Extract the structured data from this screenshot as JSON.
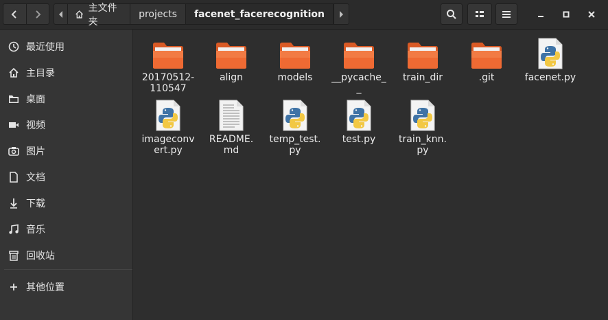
{
  "header": {
    "back_icon": "chevron-left-icon",
    "forward_icon": "chevron-right-icon",
    "breadcrumb": [
      {
        "label": "主文件夹",
        "icon": "home-icon"
      },
      {
        "label": "projects"
      },
      {
        "label": "facenet_facerecognition",
        "current": true
      }
    ],
    "buttons": [
      "search-icon",
      "view-options-icon",
      "menu-icon"
    ],
    "window_controls": [
      "minimize-icon",
      "maximize-icon",
      "close-icon"
    ]
  },
  "sidebar": {
    "items": [
      {
        "label": "最近使用",
        "icon": "clock-icon"
      },
      {
        "label": "主目录",
        "icon": "home-icon"
      },
      {
        "label": "桌面",
        "icon": "folder-icon"
      },
      {
        "label": "视频",
        "icon": "video-icon"
      },
      {
        "label": "图片",
        "icon": "camera-icon"
      },
      {
        "label": "文档",
        "icon": "document-icon"
      },
      {
        "label": "下载",
        "icon": "download-icon"
      },
      {
        "label": "音乐",
        "icon": "music-icon"
      },
      {
        "label": "回收站",
        "icon": "trash-icon"
      },
      {
        "label": "其他位置",
        "icon": "plus-icon"
      }
    ]
  },
  "files": [
    {
      "name_lines": [
        "20170512-",
        "110547"
      ],
      "type": "folder"
    },
    {
      "name_lines": [
        "align"
      ],
      "type": "folder"
    },
    {
      "name_lines": [
        "models"
      ],
      "type": "folder"
    },
    {
      "name_lines": [
        "__pycache_",
        "_"
      ],
      "type": "folder"
    },
    {
      "name_lines": [
        "train_dir"
      ],
      "type": "folder"
    },
    {
      "name_lines": [
        ".git"
      ],
      "type": "folder"
    },
    {
      "name_lines": [
        "facenet.py"
      ],
      "type": "python"
    },
    {
      "name_lines": [
        "imageconv",
        "ert.py"
      ],
      "type": "python"
    },
    {
      "name_lines": [
        "README.",
        "md"
      ],
      "type": "text"
    },
    {
      "name_lines": [
        "temp_test.",
        "py"
      ],
      "type": "python"
    },
    {
      "name_lines": [
        "test.py"
      ],
      "type": "python"
    },
    {
      "name_lines": [
        "train_knn.",
        "py"
      ],
      "type": "python"
    }
  ],
  "colors": {
    "folder_orange": "#ef6a33",
    "folder_light": "#f58b55",
    "background": "#2e2e2e",
    "sidebar": "#353535"
  }
}
